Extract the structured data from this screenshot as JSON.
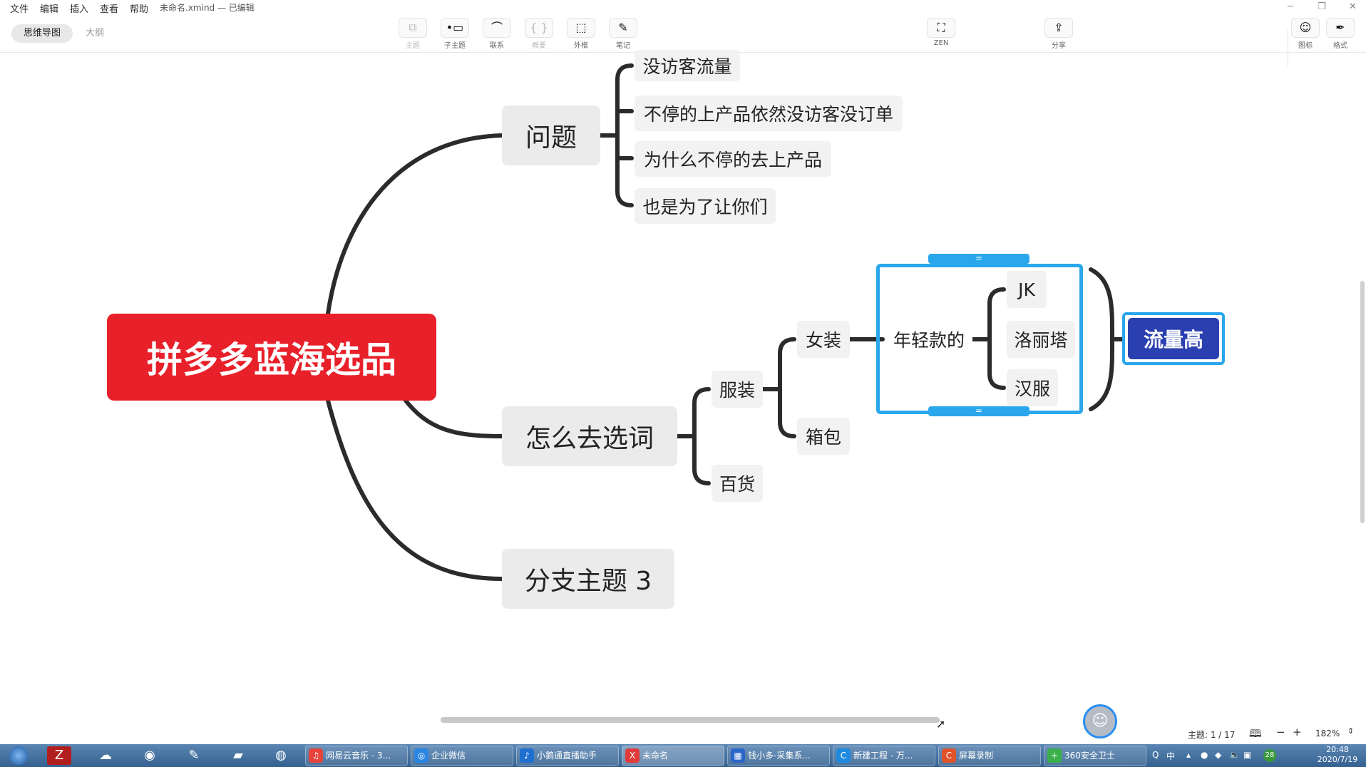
{
  "menubar": {
    "items": [
      "文件",
      "编辑",
      "插入",
      "查看",
      "帮助"
    ],
    "doc_title": "未命名.xmind — 已编辑",
    "window_controls": [
      "minimize-icon",
      "restore-icon",
      "close-icon"
    ]
  },
  "view_tabs": {
    "mindmap": "思维导图",
    "outline": "大纲"
  },
  "toolbar": {
    "topic": "主题",
    "subtopic": "子主题",
    "relationship": "联系",
    "summary": "概要",
    "boundary": "外框",
    "notes": "笔记",
    "zen": "ZEN",
    "share": "分享",
    "icons": "图标",
    "format": "格式"
  },
  "mindmap": {
    "central": "拼多多蓝海选品",
    "branch1": {
      "label": "问题",
      "children": [
        "没访客流量",
        "不停的上产品依然没访客没订单",
        "为什么不停的去上产品",
        "也是为了让你们"
      ]
    },
    "branch2": {
      "label": "怎么去选词",
      "clothing": "服装",
      "general": "百货",
      "women": "女装",
      "bags": "箱包",
      "young": "年轻款的",
      "styles": [
        "JK",
        "洛丽塔",
        "汉服"
      ],
      "summary": "流量高",
      "boundary_handle": "="
    },
    "branch3": {
      "label": "分支主题 3"
    }
  },
  "statusbar": {
    "topic_count": "主题: 1 / 17",
    "zoom": "182%"
  },
  "taskbar": {
    "pinned": [
      "start-orb-icon",
      "filezilla-icon",
      "baidu-netdisk-icon",
      "browser-icon",
      "notepad-icon",
      "folder-icon",
      "media-icon"
    ],
    "tasks": [
      {
        "label": "网易云音乐 - 3...",
        "color": "#e6443c"
      },
      {
        "label": "企业微信",
        "color": "#2a86e0"
      },
      {
        "label": "小鹅通直播助手",
        "color": "#1f6fd0"
      },
      {
        "label": "未命名",
        "color": "#e03a3a"
      },
      {
        "label": "钱小多-采集系...",
        "color": "#2a66c8"
      },
      {
        "label": "新建工程 - 万...",
        "color": "#1f8ae0"
      },
      {
        "label": "屏幕录制",
        "color": "#e0532a"
      },
      {
        "label": "360安全卫士",
        "color": "#3bb04a"
      }
    ],
    "tray": {
      "ime": "中",
      "badge": "28"
    },
    "clock_time": "20:48",
    "clock_date": "2020/7/19"
  },
  "colors": {
    "central": "#e8202a",
    "boundary": "#2aa7ec",
    "summary": "#2a3fb0",
    "link": "#2b2b2b"
  }
}
